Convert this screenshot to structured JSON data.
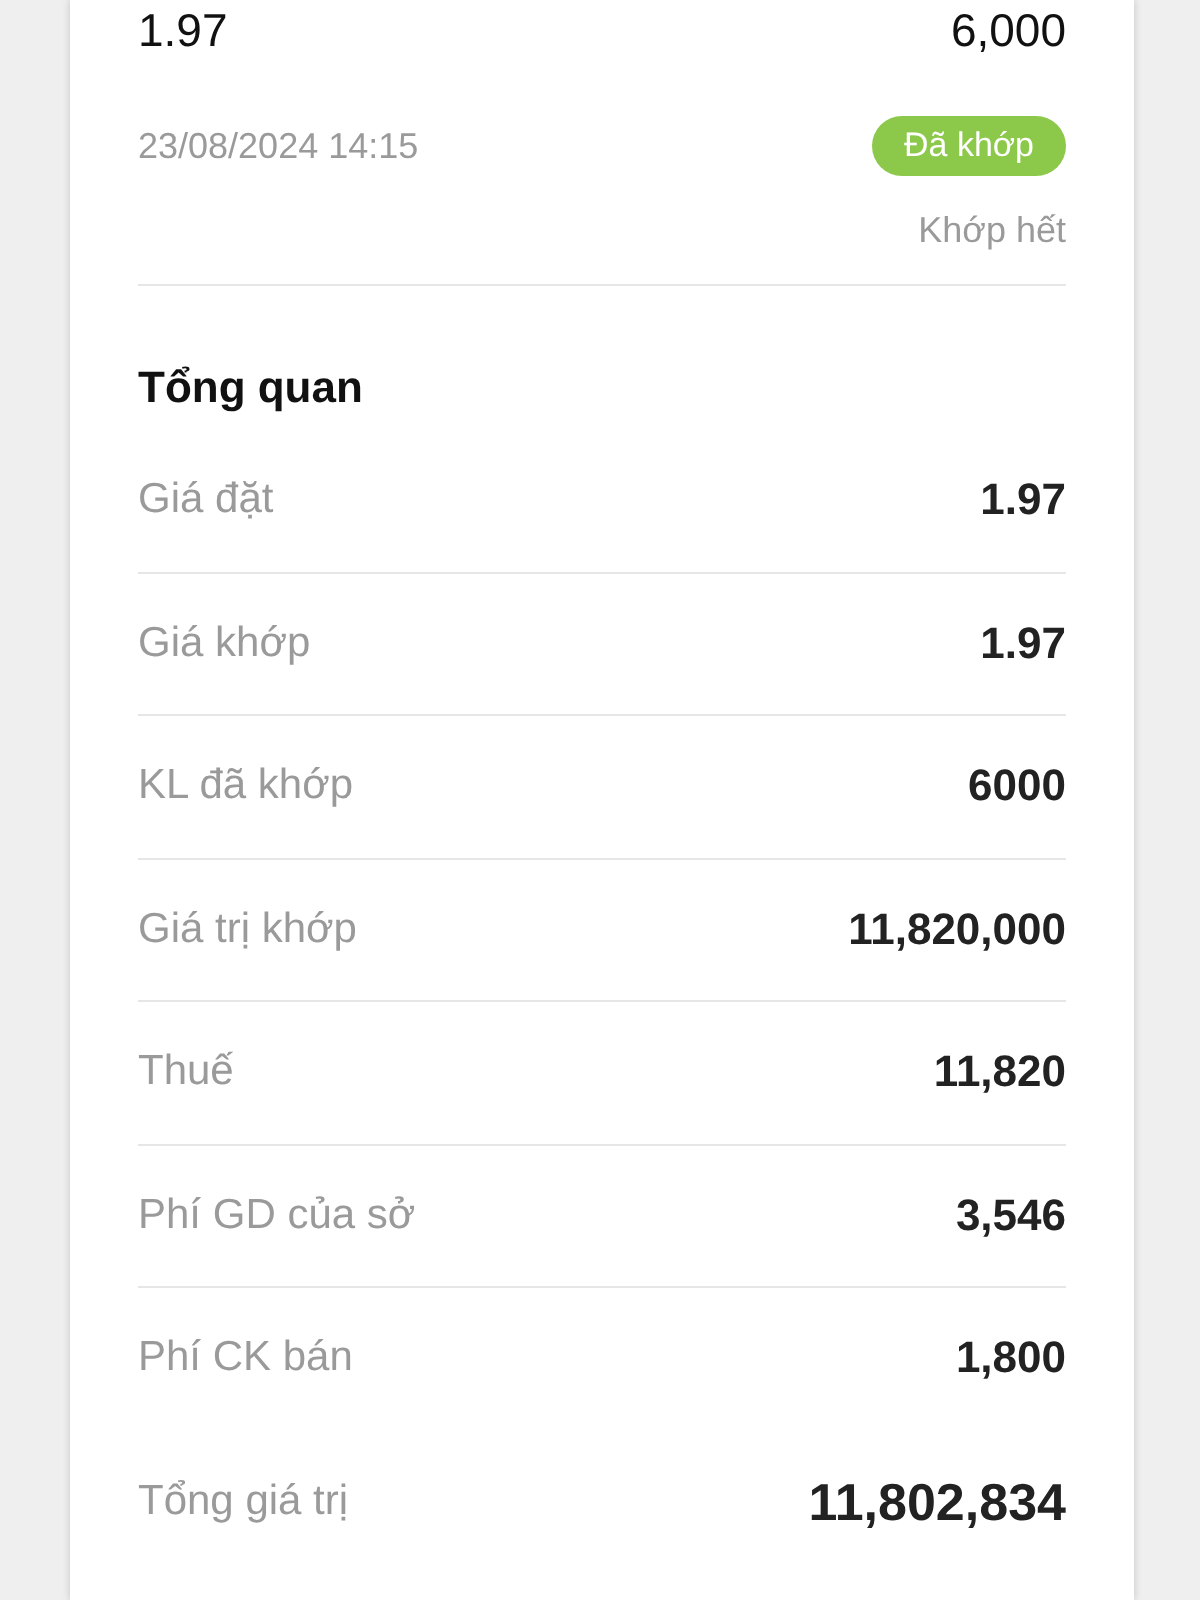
{
  "order": {
    "price": "1.97",
    "quantity": "6,000",
    "time": "23/08/2024 14:15",
    "status": {
      "label": "Đã khớp",
      "kind": "matched"
    },
    "fill_status": "Khớp hết"
  },
  "overview": {
    "title": "Tổng quan",
    "rows": [
      {
        "label": "Giá đặt",
        "value": "1.97",
        "kind": "item"
      },
      {
        "label": "Giá khớp",
        "value": "1.97",
        "kind": "item"
      },
      {
        "label": "KL đã khớp",
        "value": "6000",
        "kind": "item"
      },
      {
        "label": "Giá trị khớp",
        "value": "11,820,000",
        "kind": "item"
      },
      {
        "label": "Thuế",
        "value": "11,820",
        "kind": "item"
      },
      {
        "label": "Phí GD của sở",
        "value": "3,546",
        "kind": "item"
      },
      {
        "label": "Phí CK bán",
        "value": "1,800",
        "kind": "item"
      },
      {
        "label": "Tổng giá trị",
        "value": "11,802,834",
        "kind": "total"
      }
    ]
  }
}
